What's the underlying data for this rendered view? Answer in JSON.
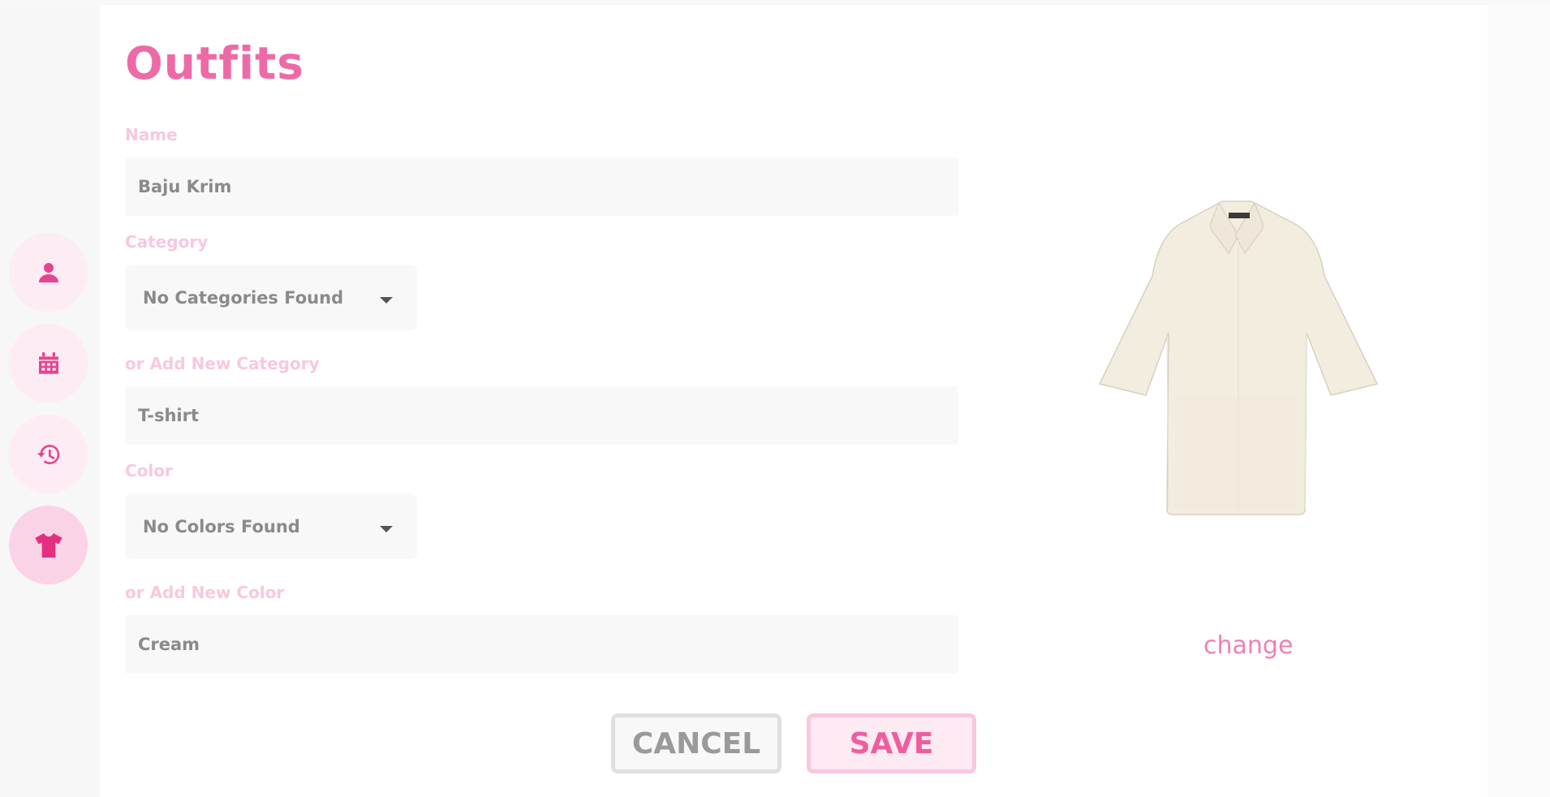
{
  "page": {
    "title": "Outfits"
  },
  "sidebar": {
    "items": [
      {
        "icon": "user-icon",
        "active": false
      },
      {
        "icon": "calendar-icon",
        "active": false
      },
      {
        "icon": "history-icon",
        "active": false
      },
      {
        "icon": "tshirt-icon",
        "active": true
      }
    ]
  },
  "form": {
    "name_label": "Name",
    "name_value": "Baju Krim",
    "category_label": "Category",
    "category_selected": "No Categories Found",
    "new_category_label": "or Add New Category",
    "new_category_value": "T-shirt",
    "color_label": "Color",
    "color_selected": "No Colors Found",
    "new_color_label": "or Add New Color",
    "new_color_value": "Cream"
  },
  "image": {
    "change_label": "change"
  },
  "actions": {
    "cancel_label": "CANCEL",
    "save_label": "SAVE"
  },
  "colors": {
    "accent": "#ee6aa7",
    "label": "#f8c8de",
    "nav_bg": "#fdecf4",
    "nav_active_bg": "#fbd3e7",
    "garment": "#f3ede0"
  }
}
